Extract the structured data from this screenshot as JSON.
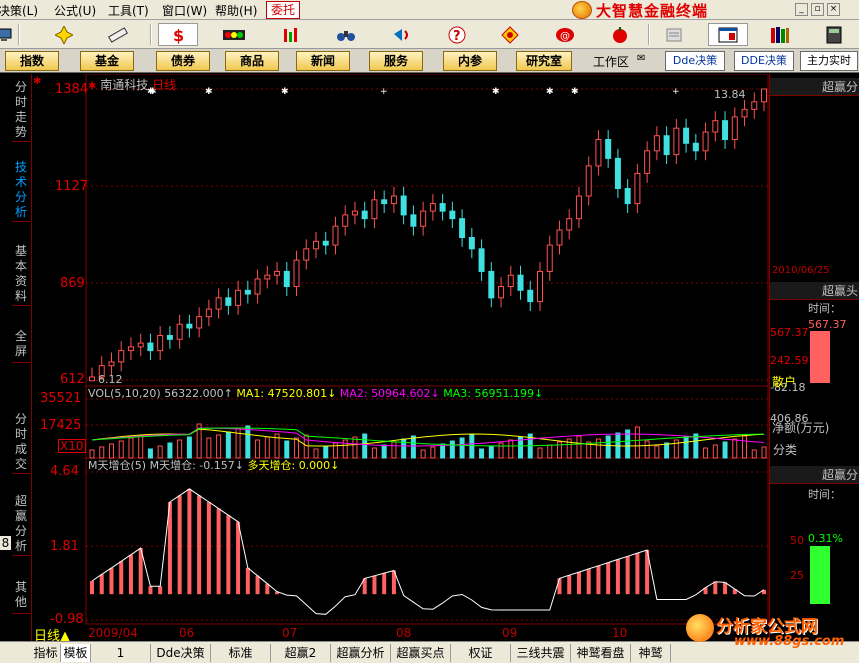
{
  "menu": {
    "items": [
      "决策(L)",
      "公式(U)",
      "工具(T)",
      "窗口(W)",
      "帮助(H)"
    ],
    "weituo": "委托",
    "brand_title": "大智慧金融终端"
  },
  "funcbar": {
    "buttons": [
      "指数",
      "基金",
      "债券",
      "商品",
      "新闻",
      "服务",
      "内参",
      "研究室"
    ],
    "workspace": "工作区",
    "dde1": "Dde决策",
    "dde2": "DDE决策",
    "realtime": "主力实时"
  },
  "sidebar": {
    "tabs": [
      "分时走势",
      "技术分析",
      "基本资料",
      "全屏",
      "分时成交",
      "超赢分析",
      "其他"
    ],
    "side_number": "8"
  },
  "stock": {
    "name": "南通科技",
    "period": "日线"
  },
  "main_panel": {
    "y_labels": [
      "1384",
      "1127",
      "869",
      "612"
    ],
    "high_label": "13.84",
    "low_label": "6.12"
  },
  "vol_panel": {
    "title": "VOL(5,10,20)",
    "value": "56322.000↑",
    "ma1_label": "MA1:",
    "ma1_value": "47520.801↓",
    "ma2_label": "MA2:",
    "ma2_value": "50964.602↓",
    "ma3_label": "MA3:",
    "ma3_value": "56951.199↓",
    "y_labels": [
      "35521",
      "17425"
    ],
    "unit": "X10"
  },
  "ind_panel": {
    "title": "M天增仓(5)",
    "m_label": "M天增仓:",
    "m_value": "-0.157↓",
    "duo_label": "多天增仓:",
    "duo_value": "0.000↓",
    "y_labels": [
      "4.64",
      "1.81",
      "-0.98"
    ]
  },
  "x_axis": {
    "period_label": "日线",
    "labels": [
      "2009/04",
      "06",
      "07",
      "08",
      "09",
      "10"
    ]
  },
  "right_panel": {
    "header1": "超赢分",
    "date": "2010/06/25",
    "header2": "超赢头",
    "time1": "时间：",
    "v1": "567.37",
    "v2": "567.37",
    "v3": "242.59",
    "v4": "-82.18",
    "v5": "406.86",
    "jinge": "净额(万元)",
    "sanhu": "散户",
    "fenlei": "分类",
    "header3": "超赢分",
    "time2": "时间：",
    "p1": "50",
    "p2": "0.31%",
    "p3": "25"
  },
  "bottom_tabs": [
    "指标",
    "模板",
    "1",
    "Dde决策",
    "标准",
    "超赢2",
    "超赢分析",
    "超赢买点",
    "权证",
    "三线共震",
    "神鹫看盘",
    "神鹫"
  ],
  "watermark": {
    "title": "分析家公式网",
    "url": "www.88gs.com"
  },
  "chart_data": {
    "type": "candlestick",
    "title": "",
    "y_range": [
      6.12,
      13.84
    ],
    "price_ticks": [
      13.84,
      11.27,
      8.69,
      6.12
    ],
    "high": 13.84,
    "low": 6.12,
    "x_labels": [
      "2009/04",
      "06",
      "07",
      "08",
      "09",
      "10"
    ],
    "close": [
      6.2,
      6.5,
      6.6,
      6.9,
      7.0,
      7.1,
      6.9,
      7.3,
      7.2,
      7.6,
      7.5,
      7.8,
      8.0,
      8.3,
      8.1,
      8.5,
      8.4,
      8.8,
      8.9,
      9.0,
      8.6,
      9.3,
      9.6,
      9.8,
      9.7,
      10.2,
      10.5,
      10.6,
      10.4,
      10.9,
      10.8,
      11.0,
      10.5,
      10.2,
      10.6,
      10.8,
      10.6,
      10.4,
      9.9,
      9.6,
      9.0,
      8.3,
      8.6,
      8.9,
      8.5,
      8.2,
      9.0,
      9.7,
      10.1,
      10.4,
      11.0,
      11.8,
      12.5,
      12.0,
      11.2,
      10.8,
      11.6,
      12.2,
      12.6,
      12.1,
      12.8,
      12.4,
      12.2,
      12.7,
      13.0,
      12.5,
      13.1,
      13.3,
      13.5,
      13.84
    ]
  }
}
